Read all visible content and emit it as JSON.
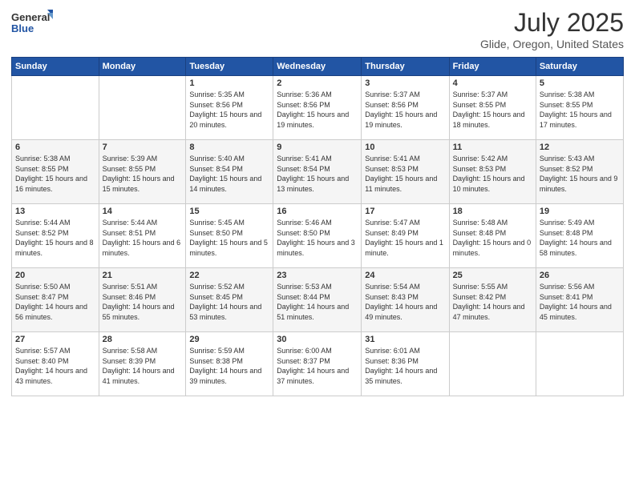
{
  "header": {
    "logo_general": "General",
    "logo_blue": "Blue",
    "title": "July 2025",
    "location": "Glide, Oregon, United States"
  },
  "weekdays": [
    "Sunday",
    "Monday",
    "Tuesday",
    "Wednesday",
    "Thursday",
    "Friday",
    "Saturday"
  ],
  "weeks": [
    [
      {
        "day": "",
        "sunrise": "",
        "sunset": "",
        "daylight": ""
      },
      {
        "day": "",
        "sunrise": "",
        "sunset": "",
        "daylight": ""
      },
      {
        "day": "1",
        "sunrise": "Sunrise: 5:35 AM",
        "sunset": "Sunset: 8:56 PM",
        "daylight": "Daylight: 15 hours and 20 minutes."
      },
      {
        "day": "2",
        "sunrise": "Sunrise: 5:36 AM",
        "sunset": "Sunset: 8:56 PM",
        "daylight": "Daylight: 15 hours and 19 minutes."
      },
      {
        "day": "3",
        "sunrise": "Sunrise: 5:37 AM",
        "sunset": "Sunset: 8:56 PM",
        "daylight": "Daylight: 15 hours and 19 minutes."
      },
      {
        "day": "4",
        "sunrise": "Sunrise: 5:37 AM",
        "sunset": "Sunset: 8:55 PM",
        "daylight": "Daylight: 15 hours and 18 minutes."
      },
      {
        "day": "5",
        "sunrise": "Sunrise: 5:38 AM",
        "sunset": "Sunset: 8:55 PM",
        "daylight": "Daylight: 15 hours and 17 minutes."
      }
    ],
    [
      {
        "day": "6",
        "sunrise": "Sunrise: 5:38 AM",
        "sunset": "Sunset: 8:55 PM",
        "daylight": "Daylight: 15 hours and 16 minutes."
      },
      {
        "day": "7",
        "sunrise": "Sunrise: 5:39 AM",
        "sunset": "Sunset: 8:55 PM",
        "daylight": "Daylight: 15 hours and 15 minutes."
      },
      {
        "day": "8",
        "sunrise": "Sunrise: 5:40 AM",
        "sunset": "Sunset: 8:54 PM",
        "daylight": "Daylight: 15 hours and 14 minutes."
      },
      {
        "day": "9",
        "sunrise": "Sunrise: 5:41 AM",
        "sunset": "Sunset: 8:54 PM",
        "daylight": "Daylight: 15 hours and 13 minutes."
      },
      {
        "day": "10",
        "sunrise": "Sunrise: 5:41 AM",
        "sunset": "Sunset: 8:53 PM",
        "daylight": "Daylight: 15 hours and 11 minutes."
      },
      {
        "day": "11",
        "sunrise": "Sunrise: 5:42 AM",
        "sunset": "Sunset: 8:53 PM",
        "daylight": "Daylight: 15 hours and 10 minutes."
      },
      {
        "day": "12",
        "sunrise": "Sunrise: 5:43 AM",
        "sunset": "Sunset: 8:52 PM",
        "daylight": "Daylight: 15 hours and 9 minutes."
      }
    ],
    [
      {
        "day": "13",
        "sunrise": "Sunrise: 5:44 AM",
        "sunset": "Sunset: 8:52 PM",
        "daylight": "Daylight: 15 hours and 8 minutes."
      },
      {
        "day": "14",
        "sunrise": "Sunrise: 5:44 AM",
        "sunset": "Sunset: 8:51 PM",
        "daylight": "Daylight: 15 hours and 6 minutes."
      },
      {
        "day": "15",
        "sunrise": "Sunrise: 5:45 AM",
        "sunset": "Sunset: 8:50 PM",
        "daylight": "Daylight: 15 hours and 5 minutes."
      },
      {
        "day": "16",
        "sunrise": "Sunrise: 5:46 AM",
        "sunset": "Sunset: 8:50 PM",
        "daylight": "Daylight: 15 hours and 3 minutes."
      },
      {
        "day": "17",
        "sunrise": "Sunrise: 5:47 AM",
        "sunset": "Sunset: 8:49 PM",
        "daylight": "Daylight: 15 hours and 1 minute."
      },
      {
        "day": "18",
        "sunrise": "Sunrise: 5:48 AM",
        "sunset": "Sunset: 8:48 PM",
        "daylight": "Daylight: 15 hours and 0 minutes."
      },
      {
        "day": "19",
        "sunrise": "Sunrise: 5:49 AM",
        "sunset": "Sunset: 8:48 PM",
        "daylight": "Daylight: 14 hours and 58 minutes."
      }
    ],
    [
      {
        "day": "20",
        "sunrise": "Sunrise: 5:50 AM",
        "sunset": "Sunset: 8:47 PM",
        "daylight": "Daylight: 14 hours and 56 minutes."
      },
      {
        "day": "21",
        "sunrise": "Sunrise: 5:51 AM",
        "sunset": "Sunset: 8:46 PM",
        "daylight": "Daylight: 14 hours and 55 minutes."
      },
      {
        "day": "22",
        "sunrise": "Sunrise: 5:52 AM",
        "sunset": "Sunset: 8:45 PM",
        "daylight": "Daylight: 14 hours and 53 minutes."
      },
      {
        "day": "23",
        "sunrise": "Sunrise: 5:53 AM",
        "sunset": "Sunset: 8:44 PM",
        "daylight": "Daylight: 14 hours and 51 minutes."
      },
      {
        "day": "24",
        "sunrise": "Sunrise: 5:54 AM",
        "sunset": "Sunset: 8:43 PM",
        "daylight": "Daylight: 14 hours and 49 minutes."
      },
      {
        "day": "25",
        "sunrise": "Sunrise: 5:55 AM",
        "sunset": "Sunset: 8:42 PM",
        "daylight": "Daylight: 14 hours and 47 minutes."
      },
      {
        "day": "26",
        "sunrise": "Sunrise: 5:56 AM",
        "sunset": "Sunset: 8:41 PM",
        "daylight": "Daylight: 14 hours and 45 minutes."
      }
    ],
    [
      {
        "day": "27",
        "sunrise": "Sunrise: 5:57 AM",
        "sunset": "Sunset: 8:40 PM",
        "daylight": "Daylight: 14 hours and 43 minutes."
      },
      {
        "day": "28",
        "sunrise": "Sunrise: 5:58 AM",
        "sunset": "Sunset: 8:39 PM",
        "daylight": "Daylight: 14 hours and 41 minutes."
      },
      {
        "day": "29",
        "sunrise": "Sunrise: 5:59 AM",
        "sunset": "Sunset: 8:38 PM",
        "daylight": "Daylight: 14 hours and 39 minutes."
      },
      {
        "day": "30",
        "sunrise": "Sunrise: 6:00 AM",
        "sunset": "Sunset: 8:37 PM",
        "daylight": "Daylight: 14 hours and 37 minutes."
      },
      {
        "day": "31",
        "sunrise": "Sunrise: 6:01 AM",
        "sunset": "Sunset: 8:36 PM",
        "daylight": "Daylight: 14 hours and 35 minutes."
      },
      {
        "day": "",
        "sunrise": "",
        "sunset": "",
        "daylight": ""
      },
      {
        "day": "",
        "sunrise": "",
        "sunset": "",
        "daylight": ""
      }
    ]
  ]
}
